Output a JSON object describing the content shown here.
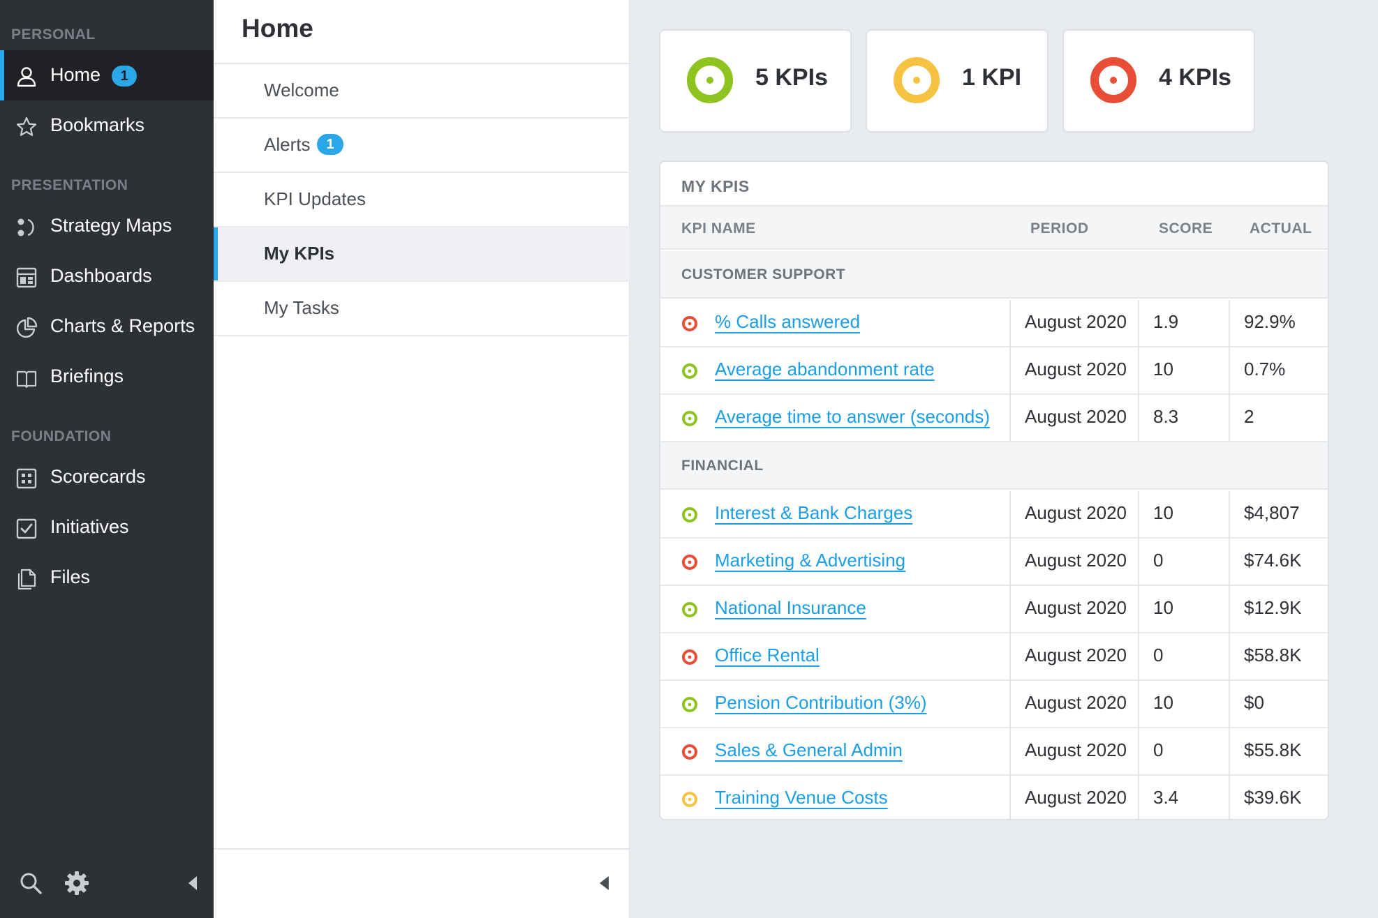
{
  "colors": {
    "accent": "#2aa7e8",
    "good": "#8fc31f",
    "warning": "#f5c242",
    "bad": "#ea4d35",
    "sidebar_bg": "#2d3035",
    "link": "#1a9ee4"
  },
  "sidebar": {
    "sections": {
      "personal": "PERSONAL",
      "presentation": "PRESENTATION",
      "foundation": "FOUNDATION"
    },
    "items": {
      "home": {
        "label": "Home",
        "badge": "1",
        "icon": "user-icon"
      },
      "bookmarks": {
        "label": "Bookmarks",
        "icon": "star-icon"
      },
      "strategy_maps": {
        "label": "Strategy Maps",
        "icon": "strategy-map-icon"
      },
      "dashboards": {
        "label": "Dashboards",
        "icon": "dashboard-icon"
      },
      "charts_reports": {
        "label": "Charts & Reports",
        "icon": "pie-chart-icon"
      },
      "briefings": {
        "label": "Briefings",
        "icon": "book-icon"
      },
      "scorecards": {
        "label": "Scorecards",
        "icon": "scorecard-icon"
      },
      "initiatives": {
        "label": "Initiatives",
        "icon": "checkbox-icon"
      },
      "files": {
        "label": "Files",
        "icon": "files-icon"
      }
    }
  },
  "midpanel": {
    "title": "Home",
    "items": [
      {
        "label": "Welcome"
      },
      {
        "label": "Alerts",
        "badge": "1"
      },
      {
        "label": "KPI Updates"
      },
      {
        "label": "My KPIs"
      },
      {
        "label": "My Tasks"
      }
    ]
  },
  "summary": [
    {
      "label": "5 KPIs",
      "status": "good"
    },
    {
      "label": "1 KPI",
      "status": "warning"
    },
    {
      "label": "4 KPIs",
      "status": "bad"
    }
  ],
  "kpis": {
    "title": "MY KPIS",
    "columns": {
      "name": "KPI NAME",
      "period": "PERIOD",
      "score": "SCORE",
      "actual": "ACTUAL"
    },
    "groups": [
      {
        "name": "CUSTOMER SUPPORT",
        "rows": [
          {
            "name": "% Calls answered",
            "period": "August 2020",
            "score": "1.9",
            "actual": "92.9%",
            "status": "bad"
          },
          {
            "name": "Average abandonment rate",
            "period": "August 2020",
            "score": "10",
            "actual": "0.7%",
            "status": "good"
          },
          {
            "name": "Average time to answer (seconds)",
            "period": "August 2020",
            "score": "8.3",
            "actual": "2",
            "status": "good"
          }
        ]
      },
      {
        "name": "FINANCIAL",
        "rows": [
          {
            "name": "Interest & Bank Charges",
            "period": "August 2020",
            "score": "10",
            "actual": "$4,807",
            "status": "good"
          },
          {
            "name": "Marketing & Advertising",
            "period": "August 2020",
            "score": "0",
            "actual": "$74.6K",
            "status": "bad"
          },
          {
            "name": "National Insurance",
            "period": "August 2020",
            "score": "10",
            "actual": "$12.9K",
            "status": "good"
          },
          {
            "name": "Office Rental",
            "period": "August 2020",
            "score": "0",
            "actual": "$58.8K",
            "status": "bad"
          },
          {
            "name": "Pension Contribution (3%)",
            "period": "August 2020",
            "score": "10",
            "actual": "$0",
            "status": "good"
          },
          {
            "name": "Sales & General Admin",
            "period": "August 2020",
            "score": "0",
            "actual": "$55.8K",
            "status": "bad"
          },
          {
            "name": "Training Venue Costs",
            "period": "August 2020",
            "score": "3.4",
            "actual": "$39.6K",
            "status": "warning"
          }
        ]
      }
    ]
  }
}
